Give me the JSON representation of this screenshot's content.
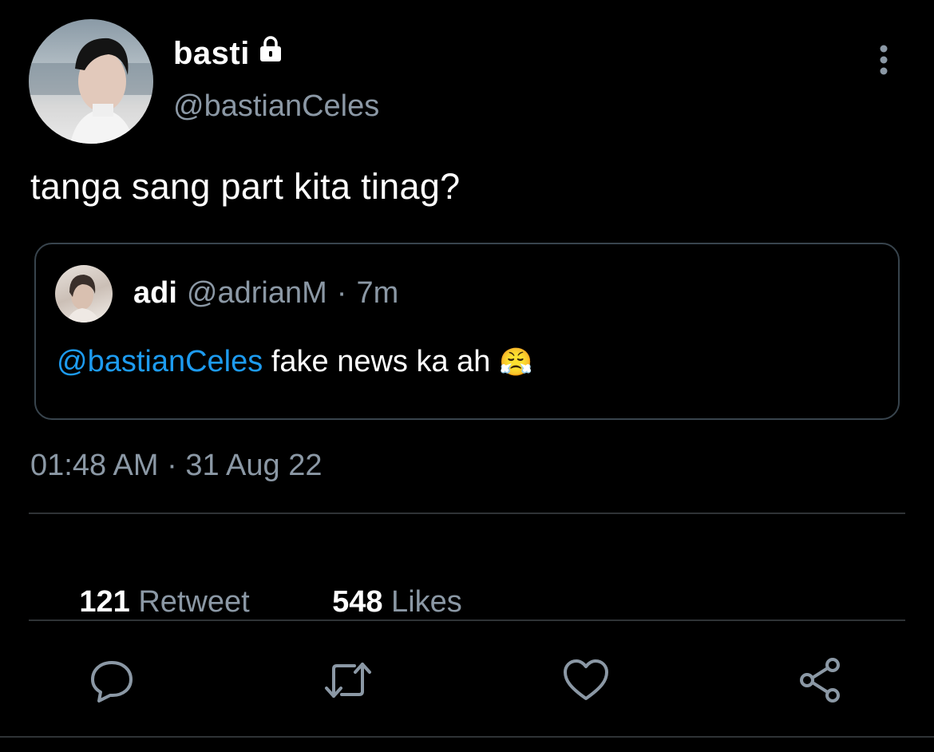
{
  "author": {
    "display_name": "basti",
    "handle": "@bastianCeles",
    "protected_icon": "lock-icon"
  },
  "tweet": {
    "text": "tanga sang part kita tinag?",
    "timestamp": "01:48 AM · 31 Aug 22"
  },
  "quoted_tweet": {
    "display_name": "adi",
    "handle": "@adrianM",
    "separator": "·",
    "time": "7m",
    "mention": "@bastianCeles",
    "text": " fake news ka ah ",
    "emoji": "😤"
  },
  "stats": {
    "retweets_count": "121",
    "retweets_label": " Retweet",
    "likes_count": "548",
    "likes_label": " Likes"
  },
  "actions": [
    "reply-icon",
    "retweet-icon",
    "like-icon",
    "share-icon"
  ],
  "colors": {
    "background": "#000000",
    "text_primary": "#ffffff",
    "text_secondary": "#8b98a5",
    "link": "#1d9bf0",
    "border": "#38444d"
  }
}
